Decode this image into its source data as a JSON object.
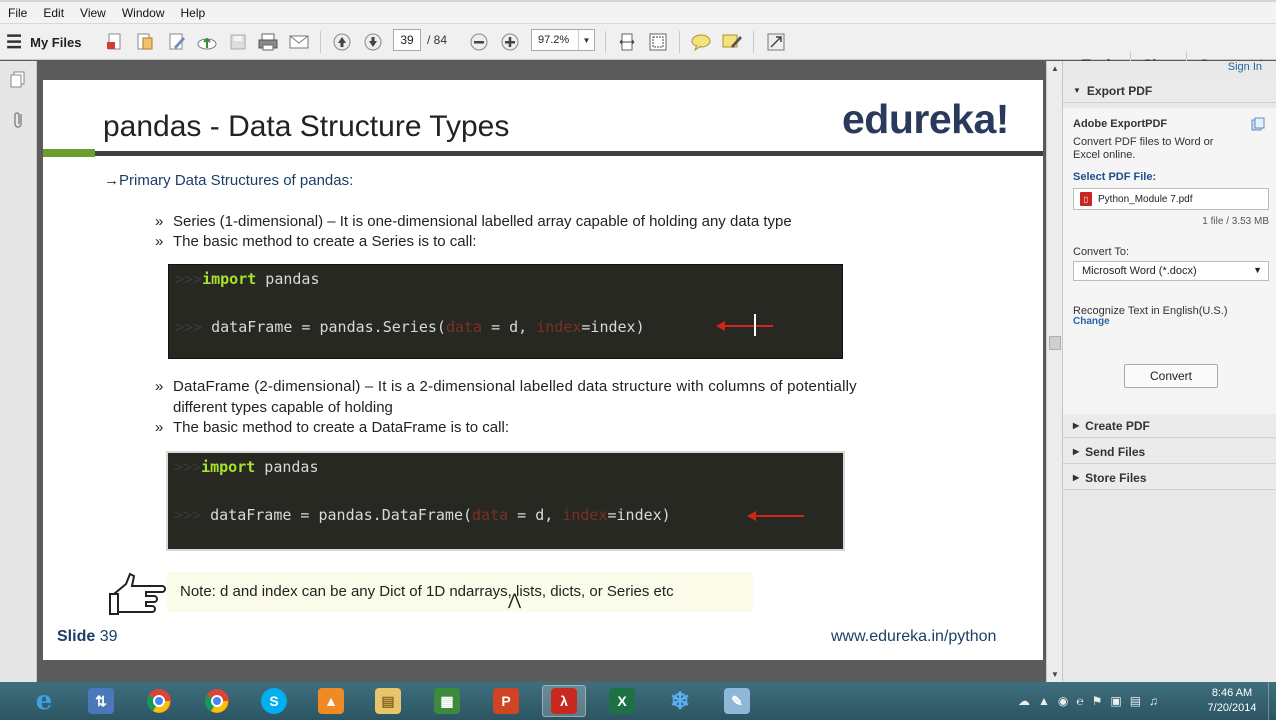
{
  "menubar": {
    "items": [
      "File",
      "Edit",
      "View",
      "Window",
      "Help"
    ]
  },
  "toolbar": {
    "my_files": "My Files",
    "current_page": "39",
    "total_pages": "/ 84",
    "zoom": "97.2%",
    "right_tabs": [
      "Tools",
      "Sign",
      "Comment"
    ]
  },
  "slide": {
    "title": "pandas - Data Structure Types",
    "logo": "edureka!",
    "primary_heading": "Primary Data Structures of pandas:",
    "bullets1": [
      "Series (1-dimensional) – It is one-dimensional labelled array capable of holding any data type",
      "The basic method to create a Series is to call:"
    ],
    "code1": {
      "line1_prompt": ">>>",
      "line1_kw": "import",
      "line1_rest": " pandas",
      "line2_prompt": ">>>",
      "line2_a": " dataFrame = pandas.Series(",
      "line2_arg1": "data",
      "line2_b": " = d, ",
      "line2_arg2": "index",
      "line2_c": "=index)"
    },
    "bullets2": [
      "DataFrame (2-dimensional) – It is a 2-dimensional labelled data structure with columns of potentially",
      "different types capable of holding",
      "The basic method to create a DataFrame is to call:"
    ],
    "code2": {
      "line1_prompt": ">>>",
      "line1_kw": "import",
      "line1_rest": " pandas",
      "line2_prompt": ">>>",
      "line2_a": " dataFrame = pandas.DataFrame(",
      "line2_arg1": "data",
      "line2_b": " = d, ",
      "line2_arg2": "index",
      "line2_c": "=index)"
    },
    "note": "Note: d and index can be any Dict of 1D ndarrays, lists, dicts, or Series etc",
    "slide_label": "Slide",
    "slide_number": "39",
    "footer_url": "www.edureka.in/python"
  },
  "right_panel": {
    "sign_in": "Sign In",
    "export_pdf": "Export PDF",
    "adobe_exportpdf": "Adobe ExportPDF",
    "description": "Convert PDF files to Word or Excel online.",
    "select_file_label": "Select PDF File:",
    "file_name": "Python_Module 7.pdf",
    "file_info": "1 file / 3.53 MB",
    "convert_to_label": "Convert To:",
    "convert_to_value": "Microsoft Word (*.docx)",
    "recognize_text": "Recognize Text in English(U.S.)",
    "change_link": "Change",
    "convert_button": "Convert",
    "create_pdf": "Create PDF",
    "send_files": "Send Files",
    "store_files": "Store Files"
  },
  "taskbar": {
    "clock_time": "8:46 AM",
    "clock_date": "7/20/2014"
  },
  "colors": {
    "accent_green": "#6a9e2f",
    "code_bg": "#272822",
    "keyword_green": "#a6e22e",
    "arrow_red": "#d0241c",
    "link_blue": "#2465a8",
    "slide_text_blue": "#1a3f66"
  }
}
